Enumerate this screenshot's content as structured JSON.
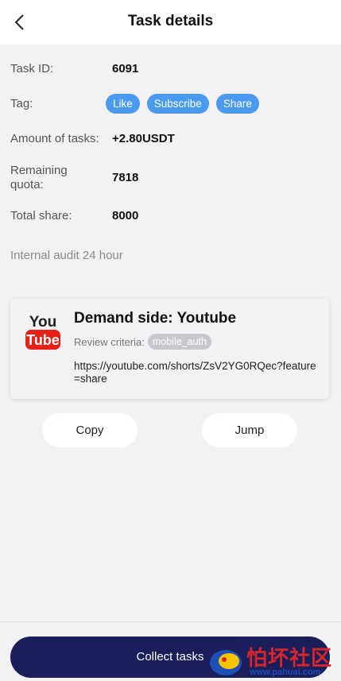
{
  "header": {
    "title": "Task details"
  },
  "fields": {
    "task_id_label": "Task ID:",
    "task_id_value": "6091",
    "tag_label": "Tag:",
    "tags": [
      "Like",
      "Subscribe",
      "Share"
    ],
    "amount_label": "Amount of tasks:",
    "amount_value": "+2.80USDT",
    "remaining_label_1": "Remaining",
    "remaining_label_2": "quota:",
    "remaining_value": "7818",
    "total_label": "Total share:",
    "total_value": "8000",
    "audit_text": "Internal audit 24 hour"
  },
  "card": {
    "logo_you": "You",
    "logo_tube": "Tube",
    "demand": "Demand side: Youtube",
    "review_label": "Review criteria:",
    "review_badge": "mobile_auth",
    "url": "https://youtube.com/shorts/ZsV2YG0RQec?feature=share"
  },
  "actions": {
    "copy": "Copy",
    "jump": "Jump",
    "collect": "Collect tasks"
  },
  "watermark": {
    "text": "怕坏社区",
    "sub": "www.pahuai.com"
  },
  "colors": {
    "tag_blue": "#4a9bf0",
    "collect_bg": "#1a1f5c",
    "youtube_red": "#e62117"
  }
}
